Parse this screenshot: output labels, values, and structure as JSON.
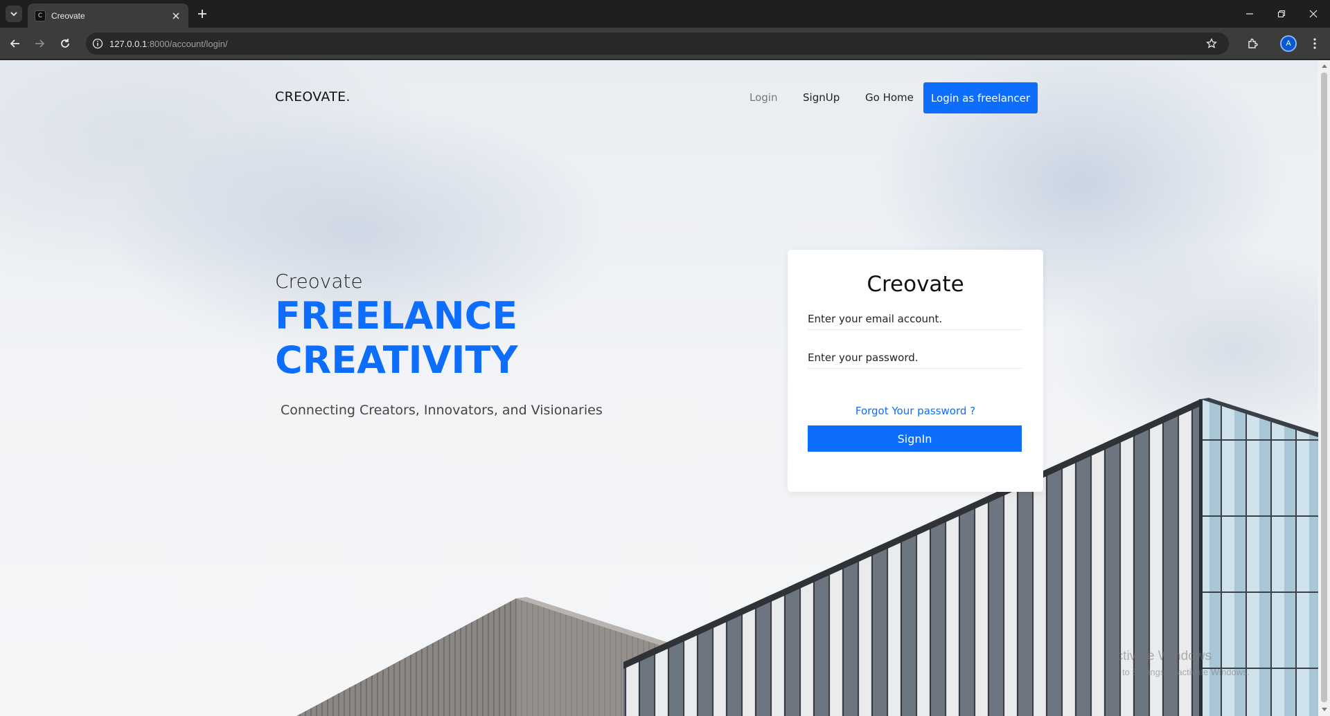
{
  "browser": {
    "tab_title": "Creovate",
    "favicon_letter": "C",
    "url_host": "127.0.0.1",
    "url_path": ":8000/account/login/",
    "profile_initial": "A"
  },
  "nav": {
    "brand": "CREOVATE.",
    "links": [
      "Login",
      "SignUp",
      "Go Home"
    ],
    "cta": "Login as freelancer"
  },
  "hero": {
    "kicker": "Creovate",
    "title_line1": "FREELANCE",
    "title_line2": "CREATIVITY",
    "subtitle": "Connecting Creators, Innovators, and Visionaries"
  },
  "login_card": {
    "title": "Creovate",
    "email_placeholder": "Enter your email account.",
    "password_placeholder": "Enter your password.",
    "forgot_link": "Forgot Your password  ?",
    "submit": "SignIn"
  },
  "watermark": {
    "line1": "Activate Windows",
    "line2": "Go to Settings to activate Windows."
  },
  "colors": {
    "accent": "#0d6efd",
    "chrome_dark": "#1f1f1f",
    "chrome_toolbar": "#3c3c3c"
  }
}
